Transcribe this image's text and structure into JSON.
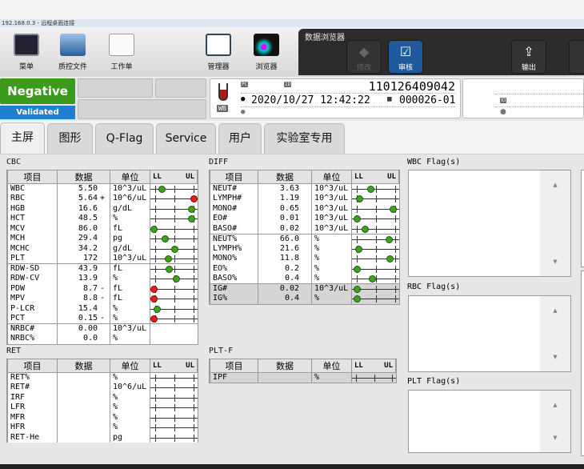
{
  "window": {
    "title": "192.168.0.3 - 远程桌面连接"
  },
  "toolbar": {
    "items": [
      {
        "label": "菜单",
        "icon": "menu-grid-icon"
      },
      {
        "label": "质控文件",
        "icon": "qc-file-icon"
      },
      {
        "label": "工作单",
        "icon": "worksheet-icon"
      },
      {
        "label": "管理器",
        "icon": "manager-icon"
      },
      {
        "label": "浏览器",
        "icon": "browser-scattergram-icon"
      }
    ]
  },
  "data_browser": {
    "title": "数据浏览器",
    "edit_label": "修改",
    "validate_label": "审核",
    "output_label": "输出"
  },
  "status": {
    "result": "Negative",
    "validation": "Validated",
    "result_color": "#3a9a1c",
    "validation_color": "#1e7fd0"
  },
  "sample": {
    "sample_no": "110126409042",
    "datetime": "2020/10/27 12:42:22",
    "rack": "000026-01",
    "mode": "WB",
    "pc_badge": "PC",
    "id_badge": "ID"
  },
  "tabs": [
    "主屏",
    "图形",
    "Q-Flag",
    "Service",
    "用户",
    "实验室专用"
  ],
  "headers": {
    "item": "项目",
    "data": "数据",
    "unit": "单位",
    "ll": "LL",
    "ul": "UL"
  },
  "colors": {
    "normal_dot": "#3fa11d",
    "abnormal_dot": "#e02020"
  },
  "cbc": {
    "title": "CBC",
    "rows": [
      {
        "item": "WBC",
        "value": "5.50",
        "flag": "",
        "unit": "10^3/uL",
        "level": 0.24,
        "abnormal": false
      },
      {
        "item": "RBC",
        "value": "5.64",
        "flag": "+",
        "unit": "10^6/uL",
        "level": 0.92,
        "abnormal": true
      },
      {
        "item": "HGB",
        "value": "16.6",
        "flag": "",
        "unit": "g/dL",
        "level": 0.87,
        "abnormal": false
      },
      {
        "item": "HCT",
        "value": "48.5",
        "flag": "",
        "unit": "%",
        "level": 0.87,
        "abnormal": false
      },
      {
        "item": "MCV",
        "value": "86.0",
        "flag": "",
        "unit": "fL",
        "level": 0.07,
        "abnormal": false
      },
      {
        "item": "MCH",
        "value": "29.4",
        "flag": "",
        "unit": "pg",
        "level": 0.3,
        "abnormal": false
      },
      {
        "item": "MCHC",
        "value": "34.2",
        "flag": "",
        "unit": "g/dL",
        "level": 0.52,
        "abnormal": false
      },
      {
        "item": "PLT",
        "value": "172",
        "flag": "",
        "unit": "10^3/uL",
        "level": 0.37,
        "abnormal": false
      },
      {
        "item": "RDW-SD",
        "value": "43.9",
        "flag": "",
        "unit": "fL",
        "level": 0.4,
        "abnormal": false,
        "sep": true
      },
      {
        "item": "RDW-CV",
        "value": "13.9",
        "flag": "",
        "unit": "%",
        "level": 0.55,
        "abnormal": false
      },
      {
        "item": "PDW",
        "value": "8.7",
        "flag": "-",
        "unit": "fL",
        "level": 0.07,
        "abnormal": true
      },
      {
        "item": "MPV",
        "value": "8.8",
        "flag": "-",
        "unit": "fL",
        "level": 0.07,
        "abnormal": true
      },
      {
        "item": "P-LCR",
        "value": "15.4",
        "flag": "",
        "unit": "%",
        "level": 0.13,
        "abnormal": false
      },
      {
        "item": "PCT",
        "value": "0.15",
        "flag": "-",
        "unit": "%",
        "level": 0.07,
        "abnormal": true
      },
      {
        "item": "NRBC#",
        "value": "0.00",
        "flag": "",
        "unit": "10^3/uL",
        "sep": true,
        "nogauge": true
      },
      {
        "item": "NRBC%",
        "value": "0.0",
        "flag": "",
        "unit": "%",
        "nogauge": true
      }
    ]
  },
  "diff": {
    "title": "DIFF",
    "rows": [
      {
        "item": "NEUT#",
        "value": "3.63",
        "flag": "",
        "unit": "10^3/uL",
        "level": 0.4
      },
      {
        "item": "LYMPH#",
        "value": "1.19",
        "flag": "",
        "unit": "10^3/uL",
        "level": 0.15
      },
      {
        "item": "MONO#",
        "value": "0.65",
        "flag": "",
        "unit": "10^3/uL",
        "level": 0.87
      },
      {
        "item": "EO#",
        "value": "0.01",
        "flag": "",
        "unit": "10^3/uL",
        "level": 0.1
      },
      {
        "item": "BASO#",
        "value": "0.02",
        "flag": "",
        "unit": "10^3/uL",
        "level": 0.27
      },
      {
        "item": "NEUT%",
        "value": "66.0",
        "flag": "",
        "unit": "%",
        "level": 0.78,
        "sep": true
      },
      {
        "item": "LYMPH%",
        "value": "21.6",
        "flag": "",
        "unit": "%",
        "level": 0.13
      },
      {
        "item": "MONO%",
        "value": "11.8",
        "flag": "",
        "unit": "%",
        "level": 0.8
      },
      {
        "item": "EO%",
        "value": "0.2",
        "flag": "",
        "unit": "%",
        "level": 0.1
      },
      {
        "item": "BASO%",
        "value": "0.4",
        "flag": "",
        "unit": "%",
        "level": 0.42
      },
      {
        "item": "IG#",
        "value": "0.02",
        "flag": "",
        "unit": "10^3/uL",
        "level": 0.1,
        "sep": true,
        "grey": true
      },
      {
        "item": "IG%",
        "value": "0.4",
        "flag": "",
        "unit": "%",
        "level": 0.1,
        "grey": true
      }
    ]
  },
  "ret": {
    "title": "RET",
    "rows": [
      {
        "item": "RET%",
        "value": "",
        "flag": "",
        "unit": "%"
      },
      {
        "item": "RET#",
        "value": "",
        "flag": "",
        "unit": "10^6/uL"
      },
      {
        "item": "IRF",
        "value": "",
        "flag": "",
        "unit": "%"
      },
      {
        "item": "LFR",
        "value": "",
        "flag": "",
        "unit": "%"
      },
      {
        "item": "MFR",
        "value": "",
        "flag": "",
        "unit": "%"
      },
      {
        "item": "HFR",
        "value": "",
        "flag": "",
        "unit": "%"
      },
      {
        "item": "RET-He",
        "value": "",
        "flag": "",
        "unit": "pg"
      }
    ]
  },
  "pltf": {
    "title": "PLT-F",
    "rows": [
      {
        "item": "IPF",
        "value": "",
        "flag": "",
        "unit": "%",
        "grey": true
      }
    ]
  },
  "flags": {
    "wbc": "WBC Flag(s)",
    "rbc": "RBC Flag(s)",
    "plt": "PLT Flag(s)"
  }
}
